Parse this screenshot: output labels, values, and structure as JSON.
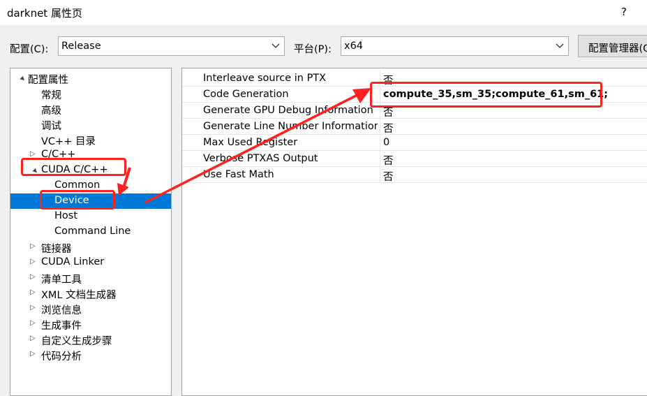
{
  "window": {
    "title": "darknet 属性页",
    "help": "?"
  },
  "toolbar": {
    "config_label": "配置(C):",
    "config_value": "Release",
    "platform_label": "平台(P):",
    "platform_value": "x64",
    "manager_button": "配置管理器(O)..."
  },
  "tree": [
    {
      "label": "配置属性",
      "expander": "▲"
    },
    {
      "label": "常规",
      "expander": ""
    },
    {
      "label": "高级",
      "expander": ""
    },
    {
      "label": "调试",
      "expander": ""
    },
    {
      "label": "VC++ 目录",
      "expander": ""
    },
    {
      "label": "C/C++",
      "expander": "▷"
    },
    {
      "label": "CUDA C/C++",
      "expander": "▲"
    },
    {
      "label": "Common",
      "expander": ""
    },
    {
      "label": "Device",
      "expander": "",
      "selected": true
    },
    {
      "label": "Host",
      "expander": ""
    },
    {
      "label": "Command Line",
      "expander": ""
    },
    {
      "label": "链接器",
      "expander": "▷"
    },
    {
      "label": "CUDA Linker",
      "expander": "▷"
    },
    {
      "label": "清单工具",
      "expander": "▷"
    },
    {
      "label": "XML 文档生成器",
      "expander": "▷"
    },
    {
      "label": "浏览信息",
      "expander": "▷"
    },
    {
      "label": "生成事件",
      "expander": "▷"
    },
    {
      "label": "自定义生成步骤",
      "expander": "▷"
    },
    {
      "label": "代码分析",
      "expander": "▷"
    }
  ],
  "properties": [
    {
      "name": "Interleave source in PTX",
      "value": "否"
    },
    {
      "name": "Code Generation",
      "value": "compute_35,sm_35;compute_61,sm_61;"
    },
    {
      "name": "Generate GPU Debug Information",
      "value": "否"
    },
    {
      "name": "Generate Line Number Information",
      "value": "否"
    },
    {
      "name": "Max Used Register",
      "value": "0"
    },
    {
      "name": "Verbose PTXAS Output",
      "value": "否"
    },
    {
      "name": "Use Fast Math",
      "value": "否"
    }
  ],
  "annotation": {
    "color": "#ff2020"
  }
}
